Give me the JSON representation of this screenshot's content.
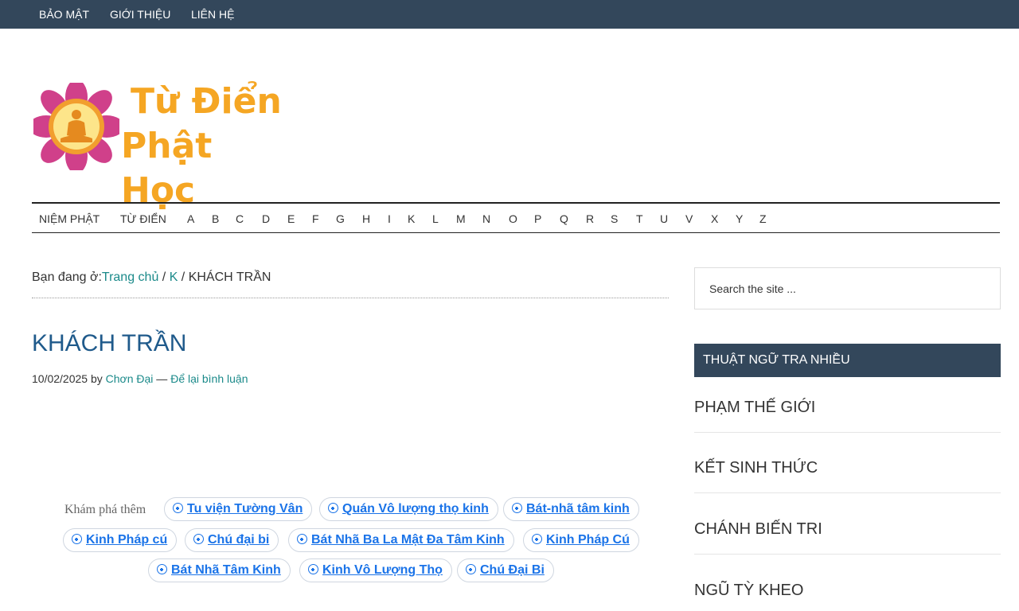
{
  "top_nav": {
    "items": [
      "BẢO MẬT",
      "GIỚI THIỆU",
      "LIÊN HỆ"
    ]
  },
  "logo": {
    "line1": "Từ Điển",
    "line2": "Phật Học",
    "colors": {
      "text": "#f5a623",
      "lotus": "#d0408a",
      "sun": "#f9c74f"
    }
  },
  "main_nav": {
    "items": [
      "NIỆM PHẬT",
      "TỪ ĐIỂN",
      "A",
      "B",
      "C",
      "D",
      "E",
      "F",
      "G",
      "H",
      "I",
      "K",
      "L",
      "M",
      "N",
      "O",
      "P",
      "Q",
      "R",
      "S",
      "T",
      "U",
      "V",
      "X",
      "Y",
      "Z"
    ]
  },
  "breadcrumb": {
    "prefix": "Bạn đang ở:",
    "home": "Trang chủ",
    "sep1": " / ",
    "category": "K",
    "sep2": " / ",
    "current": "KHÁCH TRẦN"
  },
  "post": {
    "title": "KHÁCH TRẦN",
    "date": "10/02/2025",
    "by": " by ",
    "author": "Chơn Đại",
    "dash": " — ",
    "comment_link": "Để lại bình luận"
  },
  "explore": {
    "label": "Khám phá thêm",
    "chips": [
      "Tu viện Tường Vân",
      "Quán Vô lượng thọ kinh",
      "Bát-nhã tâm kinh",
      "Kinh Pháp cú",
      "Chú đại bi",
      "Bát Nhã Ba La Mật Đa Tâm Kinh",
      "Kinh Pháp Cú",
      "Bát Nhã Tâm Kinh",
      "Kinh Vô Lượng Thọ",
      "Chú Đại Bi"
    ]
  },
  "sidebar": {
    "search_placeholder": "Search the site ...",
    "widget_title": "THUẬT NGỮ TRA NHIỀU",
    "terms": [
      "PHẠM THẾ GIỚI",
      "KẾT SINH THỨC",
      "CHÁNH BIẾN TRI",
      "NGŨ TỲ KHEO"
    ]
  },
  "colors": {
    "header_bg": "#33475b",
    "link": "#1b8a8a",
    "title": "#1f5a8b",
    "chip_text": "#1a73e8"
  }
}
